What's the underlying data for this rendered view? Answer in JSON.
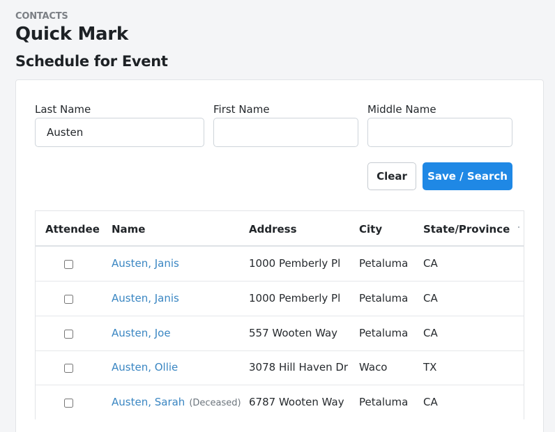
{
  "breadcrumb": "CONTACTS",
  "page_title": "Quick Mark",
  "section_title": "Schedule for Event",
  "form": {
    "last_name": {
      "label": "Last Name",
      "value": "Austen",
      "placeholder": ""
    },
    "first_name": {
      "label": "First Name",
      "value": "",
      "placeholder": ""
    },
    "middle_name": {
      "label": "Middle Name",
      "value": "",
      "placeholder": ""
    },
    "clear_label": "Clear",
    "save_label": "Save / Search"
  },
  "table": {
    "columns": [
      "Attendee",
      "Name",
      "Address",
      "City",
      "State/Province"
    ],
    "rows": [
      {
        "attendee": false,
        "name": "Austen, Janis",
        "deceased": "",
        "address": "1000 Pemberly Pl",
        "city": "Petaluma",
        "state": "CA"
      },
      {
        "attendee": false,
        "name": "Austen, Janis",
        "deceased": "",
        "address": "1000 Pemberly Pl",
        "city": "Petaluma",
        "state": "CA"
      },
      {
        "attendee": false,
        "name": "Austen, Joe",
        "deceased": "",
        "address": "557 Wooten Way",
        "city": "Petaluma",
        "state": "CA"
      },
      {
        "attendee": false,
        "name": "Austen, Ollie",
        "deceased": "",
        "address": "3078 Hill Haven Dr",
        "city": "Waco",
        "state": "TX"
      },
      {
        "attendee": false,
        "name": "Austen, Sarah",
        "deceased": "(Deceased)",
        "address": "6787 Wooten Way",
        "city": "Petaluma",
        "state": "CA"
      }
    ]
  },
  "colors": {
    "accent": "#1f88e5",
    "link": "#3a86c2",
    "muted": "#6c757d"
  }
}
